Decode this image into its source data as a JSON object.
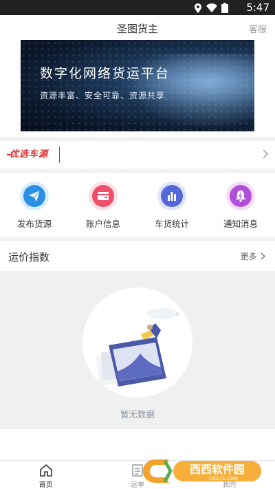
{
  "status_bar": {
    "time": "5:47",
    "icons": [
      "location-icon",
      "wifi-icon",
      "battery-icon"
    ]
  },
  "header": {
    "title": "圣图货主",
    "service_label": "客服"
  },
  "banner": {
    "headline": "数字化网络货运平台",
    "subtitle": "资源丰富、安全可靠、资源共享"
  },
  "featured": {
    "logo_text": "优选车源",
    "icon": "chevron-right-icon"
  },
  "shortcuts": [
    {
      "label": "发布货源",
      "icon": "paper-plane-icon",
      "color": "#2b8fe6"
    },
    {
      "label": "账户信息",
      "icon": "wallet-icon",
      "color": "#f0506e"
    },
    {
      "label": "车货统计",
      "icon": "bar-chart-icon",
      "color": "#5468d8"
    },
    {
      "label": "通知消息",
      "icon": "bell-icon",
      "color": "#b14fd8"
    }
  ],
  "rates": {
    "title": "运价指数",
    "more_label": "更多"
  },
  "empty": {
    "text": "暂无数据",
    "icon": "empty-folder-illustration"
  },
  "tabbar": {
    "tabs": [
      {
        "label": "首页",
        "icon": "home-icon",
        "active": true
      },
      {
        "label": "运单",
        "icon": "waybill-icon",
        "active": false
      },
      {
        "label": "我的",
        "icon": "profile-icon",
        "active": false
      }
    ]
  },
  "watermark": {
    "brand": "西西软件园",
    "url": "CR173.COM"
  },
  "colors": {
    "accent_red": "#d9302c",
    "empty_text": "#8a94a6"
  }
}
